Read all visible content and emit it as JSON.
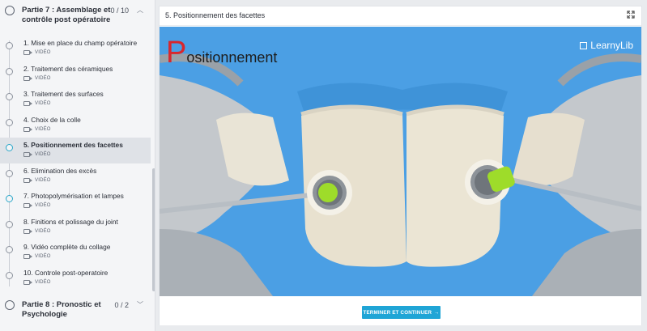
{
  "sidebar": {
    "section7": {
      "title": "Partie 7 : Assemblage et contrôle post opératoire",
      "count": "0 / 10"
    },
    "lessons": [
      {
        "label": "1. Mise en place du champ opératoire",
        "kind": "VIDÉO"
      },
      {
        "label": "2. Traitement des céramiques",
        "kind": "VIDÉO"
      },
      {
        "label": "3. Traitement des surfaces",
        "kind": "VIDÉO"
      },
      {
        "label": "4. Choix de la colle",
        "kind": "VIDÉO"
      },
      {
        "label": "5. Positionnement des facettes",
        "kind": "VIDÉO"
      },
      {
        "label": "6. Elimination des excès",
        "kind": "VIDÉO"
      },
      {
        "label": "7. Photopolymérisation et lampes",
        "kind": "VIDÉO"
      },
      {
        "label": "8. Finitions et polissage du joint",
        "kind": "VIDÉO"
      },
      {
        "label": "9. Vidéo complète du collage",
        "kind": "VIDÉO"
      },
      {
        "label": "10. Controle post-operatoire",
        "kind": "VIDÉO"
      }
    ],
    "section8": {
      "title": "Partie 8 : Pronostic et Psychologie",
      "count": "0 / 2"
    }
  },
  "main": {
    "title": "5. Positionnement des facettes",
    "video": {
      "overlay_initial": "P",
      "overlay_text": "ositionnement",
      "watermark": "LearnyLib"
    },
    "cta_label": "TERMINER ET CONTINUER",
    "cta_arrow": "→"
  },
  "colors": {
    "accent": "#1fa5d6",
    "video_bg": "#4aa0e6",
    "overlay_initial": "#d8262c"
  }
}
